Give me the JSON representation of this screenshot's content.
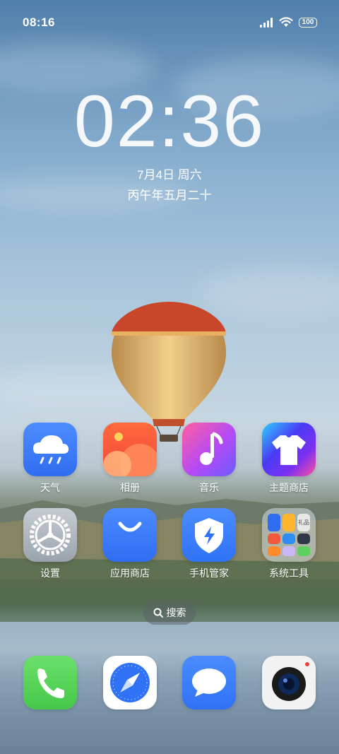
{
  "status_bar": {
    "time": "08:16",
    "battery": "100",
    "icons": [
      "signal-icon",
      "wifi-icon",
      "battery-icon"
    ]
  },
  "lock_clock": {
    "time": "02:36",
    "date": "7月4日 周六",
    "lunar_date": "丙午年五月二十"
  },
  "apps_row1": [
    {
      "label": "天气",
      "icon": "weather-icon"
    },
    {
      "label": "相册",
      "icon": "gallery-icon"
    },
    {
      "label": "音乐",
      "icon": "music-icon"
    },
    {
      "label": "主题商店",
      "icon": "theme-store-icon"
    }
  ],
  "apps_row2": [
    {
      "label": "设置",
      "icon": "settings-icon"
    },
    {
      "label": "应用商店",
      "icon": "app-store-icon"
    },
    {
      "label": "手机管家",
      "icon": "phone-manager-icon"
    },
    {
      "label": "系统工具",
      "icon": "folder-icon"
    }
  ],
  "search": {
    "label": "搜索"
  },
  "dock": [
    {
      "icon": "phone-icon"
    },
    {
      "icon": "browser-icon"
    },
    {
      "icon": "messages-icon"
    },
    {
      "icon": "camera-icon"
    }
  ],
  "folder_mini_label": "礼品",
  "colors": {
    "weather": "#2f6df0",
    "gallery": "#f25a3a",
    "music": "#b84af0",
    "theme": "#5a3cf0",
    "settings": "#9aa3ad",
    "appstore": "#2f6ef3",
    "manager": "#2f72f5",
    "phone": "#4cd964",
    "messages": "#2f72f5"
  }
}
